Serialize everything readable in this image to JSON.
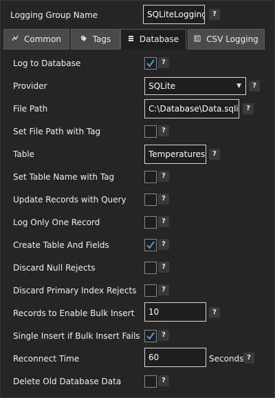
{
  "header": {
    "group_name_label": "Logging Group Name",
    "group_name_value": "SQLiteLogging",
    "help": "?"
  },
  "tabs": [
    {
      "label": "Common",
      "icon": "sliders-icon",
      "active": false
    },
    {
      "label": "Tags",
      "icon": "tag-icon",
      "active": false
    },
    {
      "label": "Database",
      "icon": "database-icon",
      "active": true
    },
    {
      "label": "CSV Logging",
      "icon": "csv-file-icon",
      "active": false
    }
  ],
  "fields": {
    "log_to_database": {
      "label": "Log to Database",
      "checked": true
    },
    "provider": {
      "label": "Provider",
      "value": "SQLite"
    },
    "file_path": {
      "label": "File Path",
      "value": "C:\\Database\\Data.sqlite"
    },
    "set_file_path_with_tag": {
      "label": "Set File Path with Tag",
      "checked": false
    },
    "table": {
      "label": "Table",
      "value": "Temperatures"
    },
    "set_table_name_with_tag": {
      "label": "Set Table Name with Tag",
      "checked": false
    },
    "update_records_with_query": {
      "label": "Update Records with Query",
      "checked": false
    },
    "log_only_one_record": {
      "label": "Log Only One Record",
      "checked": false
    },
    "create_table_and_fields": {
      "label": "Create Table And Fields",
      "checked": true
    },
    "discard_null_rejects": {
      "label": "Discard Null Rejects",
      "checked": false
    },
    "discard_primary_index_rejects": {
      "label": "Discard Primary Index Rejects",
      "checked": false
    },
    "records_to_enable_bulk_insert": {
      "label": "Records to Enable Bulk Insert",
      "value": "10"
    },
    "single_insert_if_bulk_fails": {
      "label": "Single Insert if Bulk Insert Fails",
      "checked": true
    },
    "reconnect_time": {
      "label": "Reconnect Time",
      "value": "60",
      "unit": "Seconds"
    },
    "delete_old_database_data": {
      "label": "Delete Old Database Data",
      "checked": false
    }
  },
  "colors": {
    "accent": "#4aa3df",
    "background": "#252525"
  }
}
